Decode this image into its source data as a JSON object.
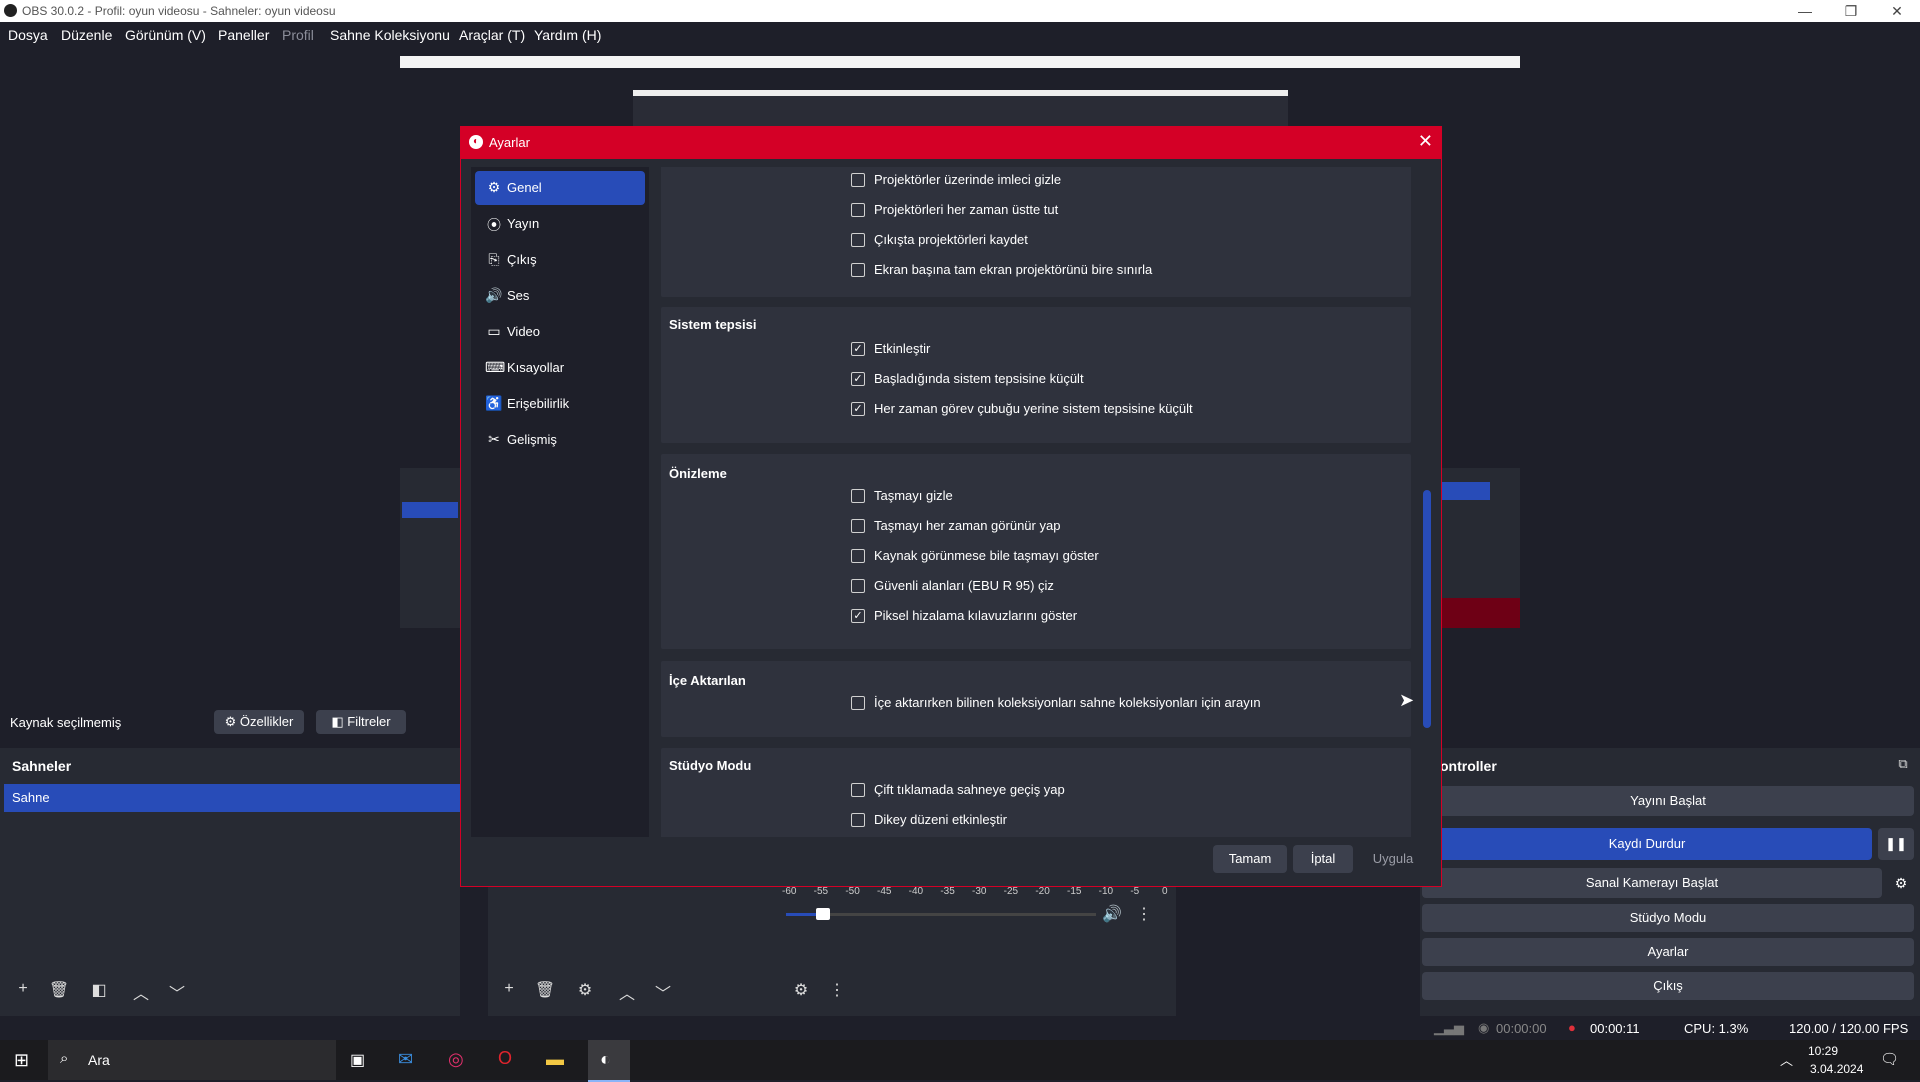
{
  "window": {
    "title": "OBS 30.0.2 - Profil: oyun videosu - Sahneler: oyun  videosu",
    "minimize": "—",
    "restore": "❐",
    "close": "✕"
  },
  "menu": [
    "Dosya",
    "Düzenle",
    "Görünüm (V)",
    "Paneller",
    "Profil",
    "Sahne Koleksiyonu",
    "Araçlar (T)",
    "Yardım (H)"
  ],
  "source_bar": {
    "label": "Kaynak seçilmemiş",
    "properties": "Özellikler",
    "filters": "Filtreler"
  },
  "scenes": {
    "title": "Sahneler",
    "items": [
      "Sahne"
    ]
  },
  "controls": {
    "title": "ontroller",
    "start_stream": "Yayını Başlat",
    "stop_record": "Kaydı Durdur",
    "virtual_cam": "Sanal Kamerayı Başlat",
    "studio_mode": "Stüdyo Modu",
    "settings": "Ayarlar",
    "exit": "Çıkış"
  },
  "mixer": {
    "ticks": [
      "-60",
      "-55",
      "-50",
      "-45",
      "-40",
      "-35",
      "-30",
      "-25",
      "-20",
      "-15",
      "-10",
      "-5",
      "0"
    ],
    "volume": 0.12
  },
  "status": {
    "stream_time": "00:00:00",
    "record_time": "00:00:11",
    "cpu": "CPU: 1.3%",
    "fps": "120.00 / 120.00 FPS"
  },
  "dialog": {
    "title": "Ayarlar",
    "sidebar": [
      {
        "label": "Genel",
        "icon": "gear-icon",
        "glyph": "⚙",
        "selected": true
      },
      {
        "label": "Yayın",
        "icon": "broadcast-icon",
        "glyph": "⦿",
        "selected": false
      },
      {
        "label": "Çıkış",
        "icon": "output-icon",
        "glyph": "⎘",
        "selected": false
      },
      {
        "label": "Ses",
        "icon": "speaker-icon",
        "glyph": "🔊",
        "selected": false
      },
      {
        "label": "Video",
        "icon": "monitor-icon",
        "glyph": "▭",
        "selected": false
      },
      {
        "label": "Kısayollar",
        "icon": "keyboard-icon",
        "glyph": "⌨",
        "selected": false
      },
      {
        "label": "Erişebilirlik",
        "icon": "accessibility-icon",
        "glyph": "♿",
        "selected": false
      },
      {
        "label": "Gelişmiş",
        "icon": "tools-icon",
        "glyph": "✂",
        "selected": false
      }
    ],
    "groups": [
      {
        "title": "",
        "options": [
          {
            "label": "Projektörler üzerinde imleci gizle",
            "checked": false
          },
          {
            "label": "Projektörleri her zaman üstte tut",
            "checked": false
          },
          {
            "label": "Çıkışta projektörleri kaydet",
            "checked": false
          },
          {
            "label": "Ekran başına tam ekran projektörünü bire sınırla",
            "checked": false
          }
        ]
      },
      {
        "title": "Sistem tepsisi",
        "options": [
          {
            "label": "Etkinleştir",
            "checked": true
          },
          {
            "label": "Başladığında sistem tepsisine küçült",
            "checked": true
          },
          {
            "label": "Her zaman görev çubuğu yerine sistem tepsisine küçült",
            "checked": true
          }
        ]
      },
      {
        "title": "Önizleme",
        "options": [
          {
            "label": "Taşmayı gizle",
            "checked": false
          },
          {
            "label": "Taşmayı her zaman görünür yap",
            "checked": false
          },
          {
            "label": "Kaynak görünmese bile taşmayı göster",
            "checked": false
          },
          {
            "label": "Güvenli alanları (EBU R 95) çiz",
            "checked": false
          },
          {
            "label": "Piksel hizalama kılavuzlarını göster",
            "checked": true
          }
        ]
      },
      {
        "title": "İçe Aktarılan",
        "options": [
          {
            "label": "İçe aktarırken bilinen koleksiyonları sahne koleksiyonları için arayın",
            "checked": false
          }
        ]
      },
      {
        "title": "Stüdyo Modu",
        "options": [
          {
            "label": "Çift tıklamada sahneye geçiş yap",
            "checked": false
          },
          {
            "label": "Dikey düzeni etkinleştir",
            "checked": false
          }
        ]
      }
    ],
    "buttons": {
      "ok": "Tamam",
      "cancel": "İptal",
      "apply": "Uygula"
    }
  },
  "taskbar": {
    "search": "Ara",
    "time": "10:29",
    "date": "3.04.2024"
  }
}
